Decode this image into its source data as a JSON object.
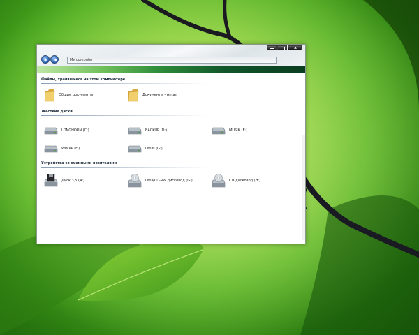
{
  "window": {
    "address": "My computer"
  },
  "sections": [
    {
      "title": "Файлы, хранящиеся на этом компьютере",
      "items": [
        {
          "label": "Общие документы",
          "icon": "folder-icon"
        },
        {
          "label": "Документы - Antan",
          "icon": "folder-icon"
        }
      ]
    },
    {
      "title": "Жесткие диски",
      "items": [
        {
          "label": "LONGHORN (C:)",
          "icon": "hard-drive-icon"
        },
        {
          "label": "BACKUP (D:)",
          "icon": "hard-drive-icon"
        },
        {
          "label": "MUSIK (E:)",
          "icon": "hard-drive-icon"
        },
        {
          "label": "WINXP (F:)",
          "icon": "hard-drive-icon"
        },
        {
          "label": "DVDs  (G:)",
          "icon": "hard-drive-icon"
        }
      ]
    },
    {
      "title": "Устройства со съемными носителями",
      "items": [
        {
          "label": "Диск 3,5 (A:)",
          "icon": "floppy-drive-icon"
        },
        {
          "label": "DVD/CD-RW дисковод (G:)",
          "icon": "dvd-drive-icon"
        },
        {
          "label": "CD-дисковод (H:)",
          "icon": "cd-drive-icon"
        }
      ]
    }
  ],
  "colors": {
    "accent_gradient_start": "#bfe7a6",
    "accent_gradient_end": "#0a3d20",
    "folder": "#e8c15a",
    "drive": "#9aa2aa"
  }
}
